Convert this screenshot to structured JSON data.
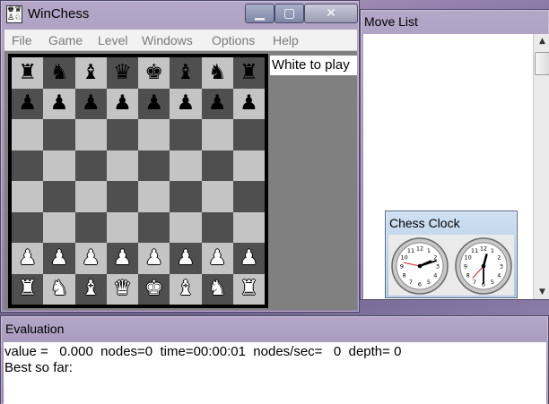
{
  "winchess": {
    "title": "WinChess",
    "icon": "chess-app-icon",
    "caption_buttons": {
      "minimize": "minimize-icon",
      "maximize": "maximize-icon",
      "close": "close-icon"
    },
    "menu": [
      "File",
      "Game",
      "Level",
      "Windows",
      "Options",
      "Help"
    ],
    "status_text": "White to play",
    "board": {
      "ranks": [
        [
          "r",
          "n",
          "b",
          "q",
          "k",
          "b",
          "n",
          "r"
        ],
        [
          "p",
          "p",
          "p",
          "p",
          "p",
          "p",
          "p",
          "p"
        ],
        [
          "",
          "",
          "",
          "",
          "",
          "",
          "",
          ""
        ],
        [
          "",
          "",
          "",
          "",
          "",
          "",
          "",
          ""
        ],
        [
          "",
          "",
          "",
          "",
          "",
          "",
          "",
          ""
        ],
        [
          "",
          "",
          "",
          "",
          "",
          "",
          "",
          ""
        ],
        [
          "P",
          "P",
          "P",
          "P",
          "P",
          "P",
          "P",
          "P"
        ],
        [
          "R",
          "N",
          "B",
          "Q",
          "K",
          "B",
          "N",
          "R"
        ]
      ],
      "light_square_color": "#c4c4c4",
      "dark_square_color": "#4f4f4f"
    }
  },
  "move_list": {
    "title": "Move List",
    "scrollbar": {
      "up": "scroll-up-arrow-icon",
      "down": "scroll-down-arrow-icon"
    }
  },
  "chess_clock": {
    "title": "Chess Clock",
    "white_clock": {
      "hour": 2,
      "minute": 12,
      "second": 47
    },
    "black_clock": {
      "hour": 12,
      "minute": 30,
      "second": 37
    }
  },
  "evaluation": {
    "title": "Evaluation",
    "line1": "value =   0.000  nodes=0  time=00:00:01  nodes/sec=   0  depth= 0",
    "line2": "Best so far:"
  }
}
